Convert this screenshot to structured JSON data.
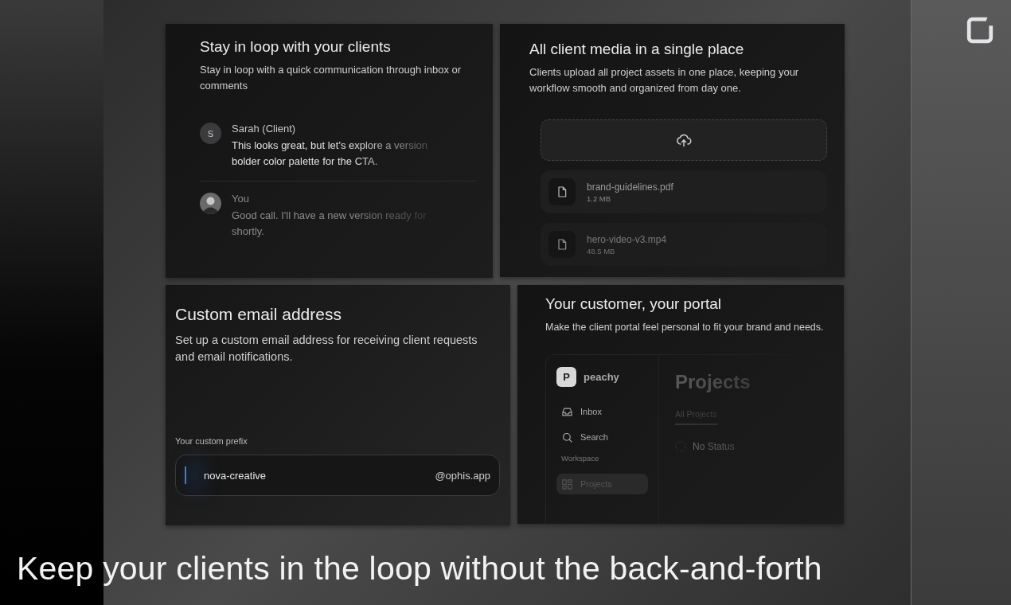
{
  "comments_card": {
    "title": "Stay in loop with your clients",
    "description": "Stay in loop with a quick communication through inbox or comments",
    "comments": [
      {
        "kind": "letter",
        "initial": "S",
        "author": "Sarah (Client)",
        "text": "This looks great, but let's explore a version bolder color palette for the CTA."
      },
      {
        "kind": "photo",
        "author": "You",
        "text": "Good call. I'll have a new version ready for shortly."
      }
    ]
  },
  "media_card": {
    "title": "All client media in a single place",
    "description": "Clients upload all project assets in one place, keeping your workflow smooth and organized from day one.",
    "files": [
      {
        "name": "brand-guidelines.pdf",
        "size": "1.2 MB"
      },
      {
        "name": "hero-video-v3.mp4",
        "size": "48.5 MB"
      }
    ]
  },
  "email_card": {
    "title": "Custom email address",
    "description": "Set up a custom email address for receiving client requests and email notifications.",
    "field_label": "Your custom prefix",
    "value": "nova-creative",
    "suffix": "@ophis.app",
    "focused": true
  },
  "portal_card": {
    "title": "Your customer, your portal",
    "description": "Make the client portal feel personal to fit your brand and needs.",
    "brand_initial": "P",
    "brand": "peachy",
    "nav": [
      {
        "kind": "inbox",
        "label": "Inbox",
        "selected": false
      },
      {
        "kind": "search",
        "label": "Search",
        "selected": false
      },
      {
        "kind": "section",
        "label": "Workspace"
      },
      {
        "kind": "projects",
        "label": "Projects",
        "selected": true
      }
    ],
    "heading": "Projects",
    "tab": {
      "label": "All Projects",
      "selected": true
    },
    "status": "No Status"
  },
  "caption": "Keep your clients in the loop without the back-and-forth"
}
